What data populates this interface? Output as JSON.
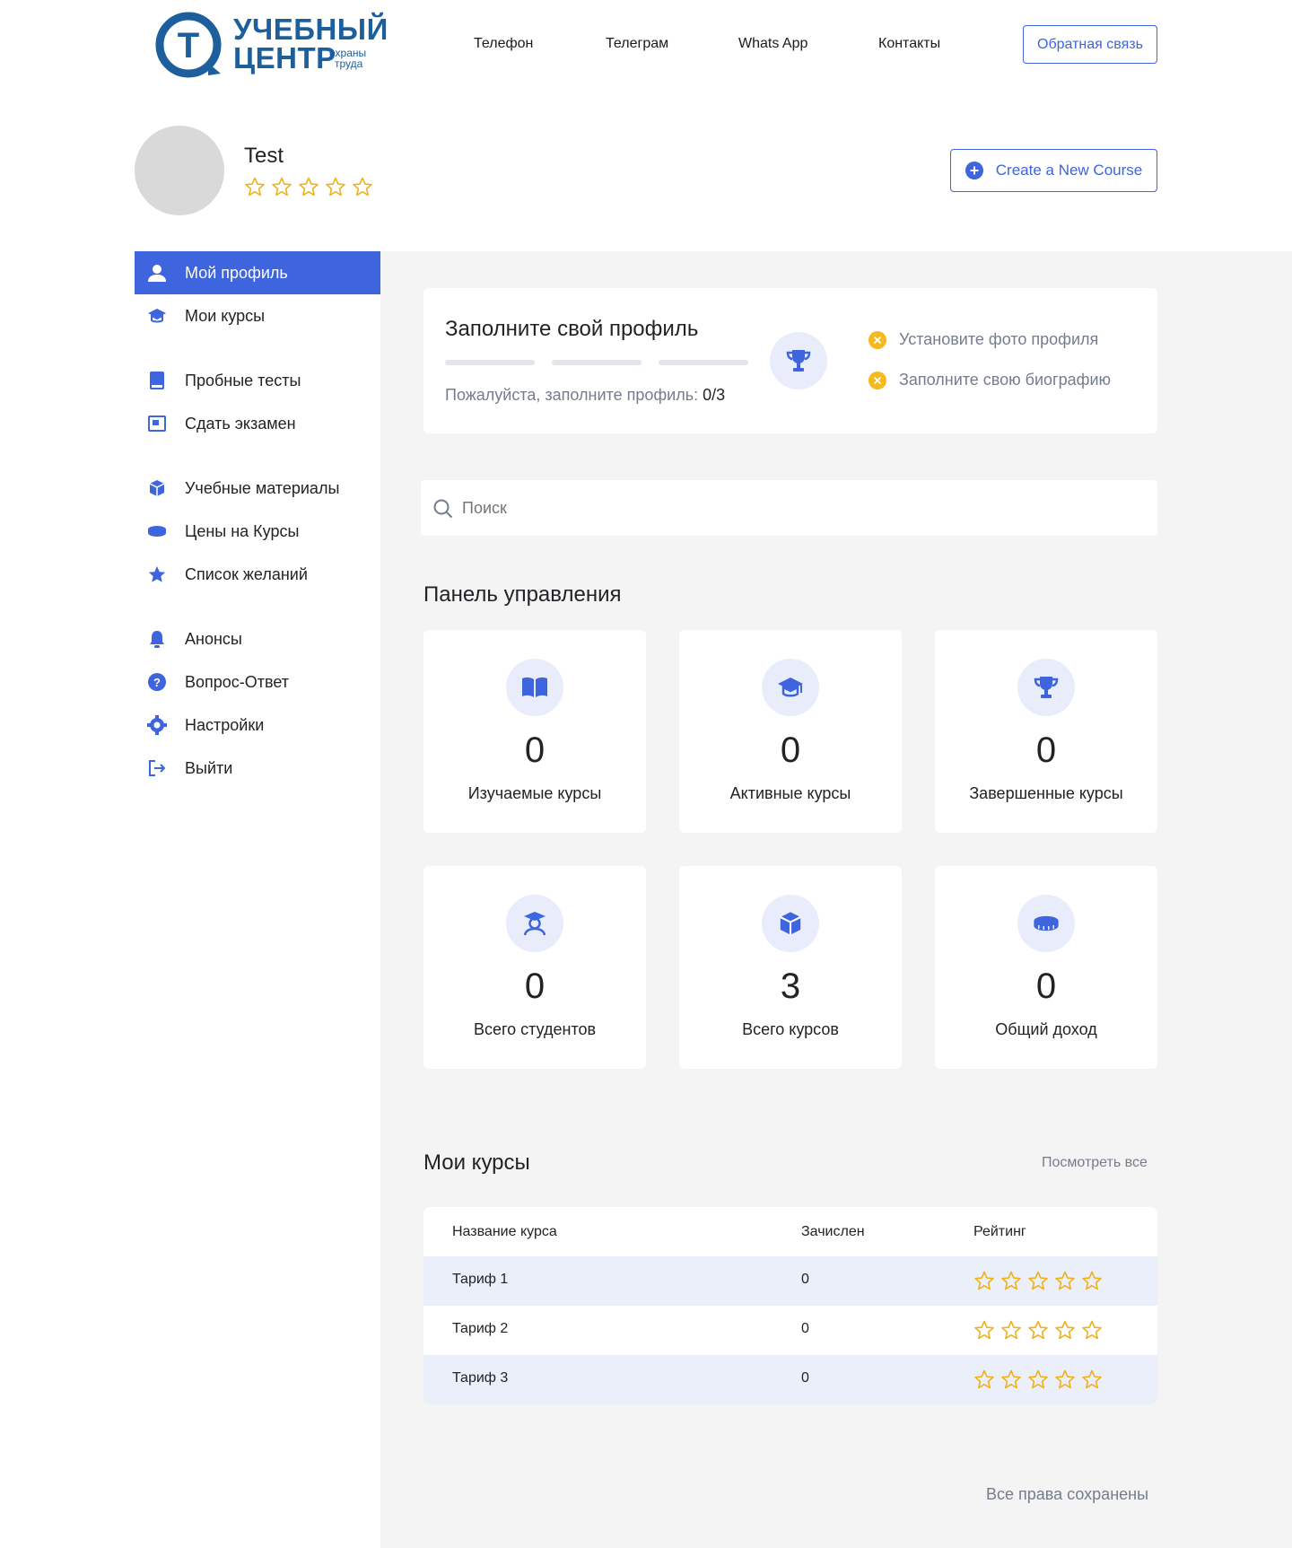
{
  "header": {
    "logo": {
      "line1": "УЧЕБНЫЙ",
      "line2": "ЦЕНТР",
      "line3a": "охраны",
      "line3b": "труда",
      "letter": "Т"
    },
    "nav": [
      {
        "label": "Телефон"
      },
      {
        "label": "Телеграм"
      },
      {
        "label": "Whats App"
      },
      {
        "label": "Контакты"
      }
    ],
    "feedback_label": "Обратная связь"
  },
  "profile": {
    "name": "Test",
    "rating_stars": 5,
    "rating_value": 0,
    "create_course_label": "Create a New Course"
  },
  "sidebar": {
    "items": [
      {
        "label": "Мой профиль",
        "icon": "user-icon",
        "active": true
      },
      {
        "label": "Мои курсы",
        "icon": "graduation-cap-icon"
      },
      {
        "label": "Пробные тесты",
        "icon": "book-icon"
      },
      {
        "label": "Сдать экзамен",
        "icon": "certificate-icon"
      },
      {
        "label": "Учебные материалы",
        "icon": "box-icon"
      },
      {
        "label": "Цены на Курсы",
        "icon": "coins-icon"
      },
      {
        "label": "Список желаний",
        "icon": "star-icon"
      },
      {
        "label": "Анонсы",
        "icon": "bell-icon"
      },
      {
        "label": "Вопрос-Ответ",
        "icon": "question-icon"
      },
      {
        "label": "Настройки",
        "icon": "gear-icon"
      },
      {
        "label": "Выйти",
        "icon": "logout-icon"
      }
    ]
  },
  "completion": {
    "title": "Заполните свой профиль",
    "hint": "Пожалуйста, заполните профиль:",
    "progress": "0/3",
    "progress_fraction": 0,
    "tasks": [
      {
        "label": "Установите фото профиля"
      },
      {
        "label": "Заполните свою биографию"
      }
    ]
  },
  "search": {
    "placeholder": "Поиск"
  },
  "dashboard": {
    "title": "Панель управления",
    "stats": [
      {
        "value": "0",
        "label": "Изучаемые курсы",
        "icon": "open-book-icon"
      },
      {
        "value": "0",
        "label": "Активные курсы",
        "icon": "graduation-cap-icon"
      },
      {
        "value": "0",
        "label": "Завершенные курсы",
        "icon": "trophy-icon"
      },
      {
        "value": "0",
        "label": "Всего студентов",
        "icon": "student-icon"
      },
      {
        "value": "3",
        "label": "Всего курсов",
        "icon": "box-icon"
      },
      {
        "value": "0",
        "label": "Общий доход",
        "icon": "coins-icon"
      }
    ]
  },
  "my_courses": {
    "title": "Мои курсы",
    "view_all": "Посмотреть все",
    "columns": [
      "Название курса",
      "Зачислен",
      "Рейтинг"
    ],
    "rows": [
      {
        "name": "Тариф 1",
        "enrolled": "0",
        "rating": 0
      },
      {
        "name": "Тариф 2",
        "enrolled": "0",
        "rating": 0
      },
      {
        "name": "Тариф 3",
        "enrolled": "0",
        "rating": 0
      }
    ]
  },
  "footer": {
    "copyright": "Все права сохранены"
  },
  "colors": {
    "accent": "#3e64de",
    "star": "#f0b11d",
    "warning": "#f5b81f",
    "panel_bg": "#f4f4f4",
    "row_alt": "#ebeff9"
  }
}
